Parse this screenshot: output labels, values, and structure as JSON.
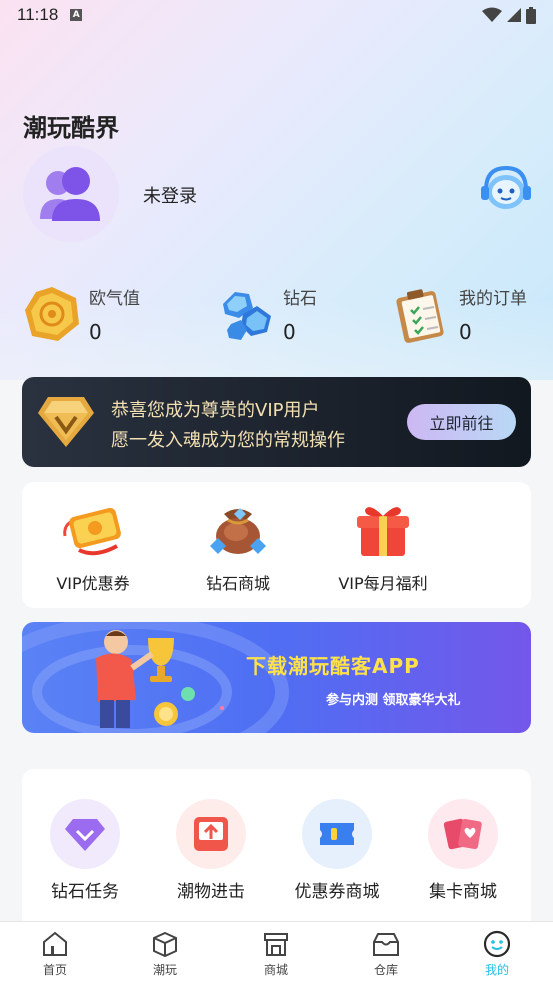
{
  "status_bar": {
    "time": "11:18",
    "notification_icon": "A"
  },
  "profile": {
    "app_title": "潮玩酷界",
    "login_status": "未登录"
  },
  "stats": [
    {
      "label": "欧气值",
      "value": "0",
      "icon": "luck-coin-icon"
    },
    {
      "label": "钻石",
      "value": "0",
      "icon": "diamond-icon"
    },
    {
      "label": "我的订单",
      "value": "0",
      "icon": "clipboard-icon"
    }
  ],
  "vip_banner": {
    "line1": "恭喜您成为尊贵的VIP用户",
    "line2": "愿一发入魂成为您的常规操作",
    "button_label": "立即前往"
  },
  "perks": [
    {
      "label": "VIP优惠券",
      "icon": "vip-ticket-icon"
    },
    {
      "label": "钻石商城",
      "icon": "diamond-bag-icon"
    },
    {
      "label": "VIP每月福利",
      "icon": "gift-box-icon"
    }
  ],
  "download_banner": {
    "title": "下载潮玩酷客APP",
    "subtitle": "参与内测 领取豪华大礼"
  },
  "services": [
    {
      "label": "钻石任务",
      "icon": "diamond-task-icon",
      "bg": "#f1eafd"
    },
    {
      "label": "潮物进击",
      "icon": "upload-box-icon",
      "bg": "#fdecea"
    },
    {
      "label": "优惠券商城",
      "icon": "coupon-icon",
      "bg": "#e6f0fd"
    },
    {
      "label": "集卡商城",
      "icon": "cards-icon",
      "bg": "#fde9ee"
    }
  ],
  "tabbar": [
    {
      "label": "首页",
      "icon": "home-icon",
      "active": false
    },
    {
      "label": "潮玩",
      "icon": "cube-icon",
      "active": false
    },
    {
      "label": "商城",
      "icon": "store-icon",
      "active": false
    },
    {
      "label": "仓库",
      "icon": "warehouse-icon",
      "active": false
    },
    {
      "label": "我的",
      "icon": "profile-face-icon",
      "active": true
    }
  ],
  "colors": {
    "accent": "#23c0e6",
    "vip_gold": "#f3e0b2",
    "download_yellow": "#ffe14a"
  }
}
